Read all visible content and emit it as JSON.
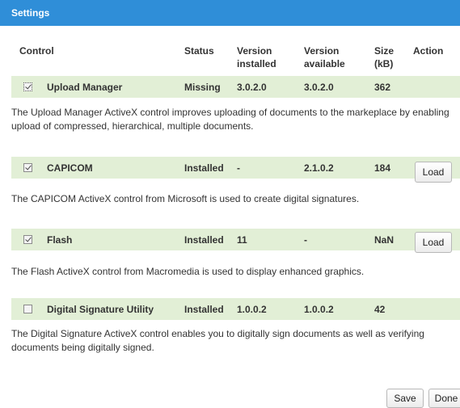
{
  "dialog": {
    "title": "Settings"
  },
  "headers": {
    "control": "Control",
    "status": "Status",
    "version_installed_1": "Version",
    "version_installed_2": "installed",
    "version_available_1": "Version",
    "version_available_2": "available",
    "size_1": "Size",
    "size_2": "(kB)",
    "action": "Action"
  },
  "controls": [
    {
      "name": "Upload Manager",
      "checked": true,
      "status": "Missing",
      "version_installed": "3.0.2.0",
      "version_available": "3.0.2.0",
      "size": "362",
      "action": "",
      "description": "The Upload Manager ActiveX control improves uploading of documents to the markeplace by enabling upload of compressed, hierarchical, multiple documents."
    },
    {
      "name": "CAPICOM",
      "checked": true,
      "status": "Installed",
      "version_installed": "-",
      "version_available": "2.1.0.2",
      "size": "184",
      "action": "Load",
      "description": "The CAPICOM ActiveX control from Microsoft is used to create digital signatures."
    },
    {
      "name": "Flash",
      "checked": true,
      "status": "Installed",
      "version_installed": "11",
      "version_available": "-",
      "size": "NaN",
      "action": "Load",
      "description": "The Flash ActiveX control from Macromedia is used to display enhanced graphics."
    },
    {
      "name": "Digital Signature Utility",
      "checked": false,
      "status": "Installed",
      "version_installed": "1.0.0.2",
      "version_available": "1.0.0.2",
      "size": "42",
      "action": "",
      "description": "The Digital Signature ActiveX control enables you to digitally sign documents as well as verifying documents being digitally signed."
    }
  ],
  "footer": {
    "save_label": "Save",
    "done_label": "Done"
  },
  "colors": {
    "titlebar": "#2f8ed8",
    "row_background": "#e2efd6"
  }
}
